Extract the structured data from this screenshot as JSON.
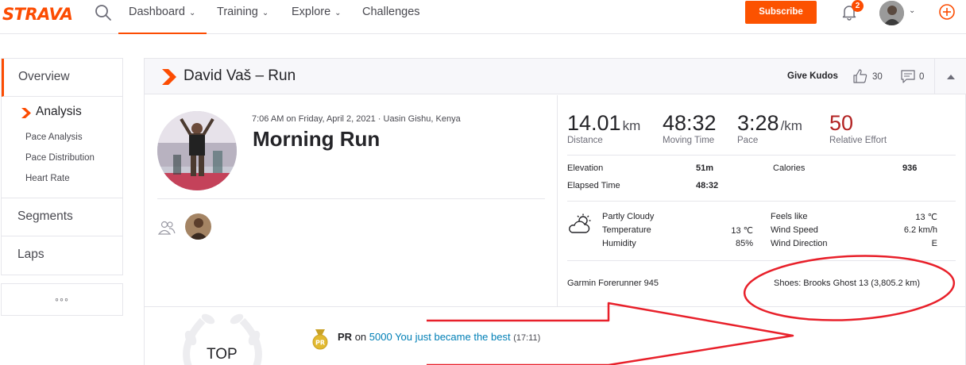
{
  "nav": {
    "logo": "STRAVA",
    "items": [
      {
        "label": "Dashboard"
      },
      {
        "label": "Training"
      },
      {
        "label": "Explore"
      },
      {
        "label": "Challenges"
      }
    ],
    "subscribe_label": "Subscribe",
    "notification_count": "2",
    "icons": [
      "search-icon",
      "bell-icon",
      "chevron-down-icon",
      "plus-circle-icon"
    ]
  },
  "sidebar": {
    "overview": "Overview",
    "analysis": "Analysis",
    "analysis_items": [
      "Pace Analysis",
      "Pace Distribution",
      "Heart Rate"
    ],
    "segments": "Segments",
    "laps": "Laps",
    "more": "◦◦◦"
  },
  "activity": {
    "header_title": "David Vaš – Run",
    "give_kudos": "Give Kudos",
    "kudos_count": "30",
    "comment_count": "0",
    "meta": "7:06 AM on Friday, April 2, 2021 · Uasin Gishu, Kenya",
    "name": "Morning Run"
  },
  "stats": {
    "distance": {
      "value": "14.01",
      "unit": "km",
      "label": "Distance"
    },
    "moving_time": {
      "value": "48:32",
      "label": "Moving Time"
    },
    "pace": {
      "value": "3:28",
      "unit": "/km",
      "label": "Pace"
    },
    "relative_effort": {
      "value": "50",
      "label": "Relative Effort"
    },
    "elevation": {
      "label": "Elevation",
      "value": "51m"
    },
    "elapsed_time": {
      "label": "Elapsed Time",
      "value": "48:32"
    },
    "calories": {
      "label": "Calories",
      "value": "936"
    }
  },
  "weather": {
    "condition": "Partly Cloudy",
    "temperature_label": "Temperature",
    "temperature_value": "13 ℃",
    "humidity_label": "Humidity",
    "humidity_value": "85%",
    "feels_like_label": "Feels like",
    "feels_like_value": "13 ℃",
    "wind_speed_label": "Wind Speed",
    "wind_speed_value": "6.2 km/h",
    "wind_direction_label": "Wind Direction",
    "wind_direction_value": "E"
  },
  "gear": {
    "device": "Garmin Forerunner 945",
    "shoes": "Shoes: Brooks Ghost 13 (3,805.2 km)"
  },
  "achievements": {
    "pr_label": "PR",
    "pr_on": "on",
    "segment_name": "5000 You just became the best",
    "time": "(17:11)",
    "medal_text": "PR",
    "top_label": "TOP"
  },
  "colors": {
    "brand": "#fc4c02",
    "link": "#007fb6",
    "effort": "#b22222",
    "annotation": "#e8202a"
  }
}
